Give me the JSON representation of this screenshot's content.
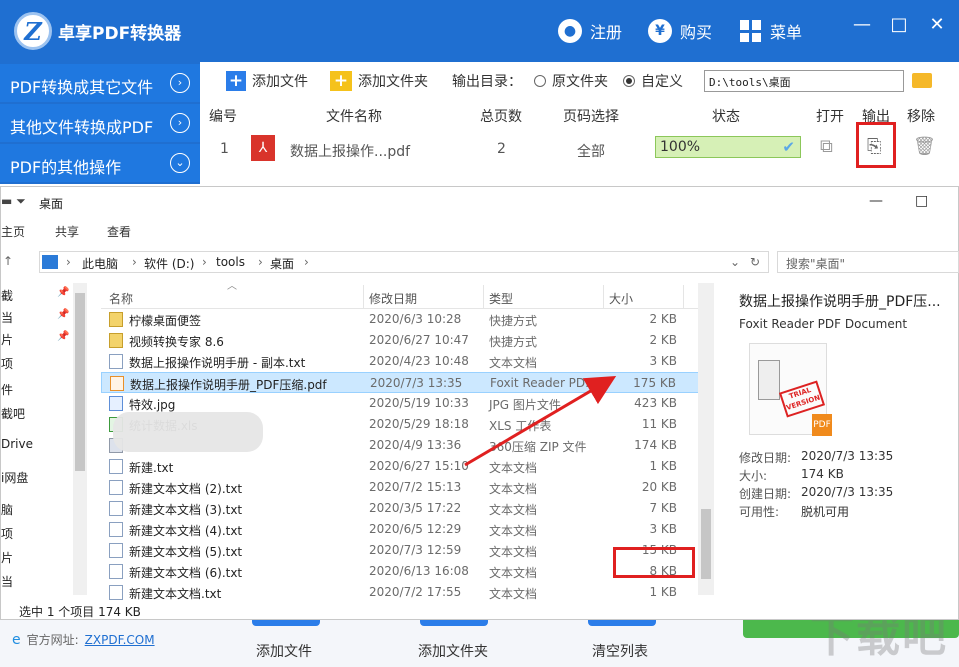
{
  "app": {
    "title": "卓享PDF转换器",
    "logo_letter": "Z",
    "titlebar_buttons": {
      "register": "注册",
      "buy": "购买",
      "menu": "菜单"
    },
    "titlebar_icons": {
      "register": "user-icon",
      "buy": "yen-icon",
      "menu": "grid-icon"
    },
    "window_controls": {
      "minimize": "—",
      "maximize": "□",
      "close": "✕"
    },
    "colors": {
      "brand": "#1f6fd1",
      "highlight": "#e02020",
      "progress": "#d6f0b6"
    }
  },
  "sidebar": {
    "items": [
      {
        "label": "PDF转换成其它文件"
      },
      {
        "label": "其他文件转换成PDF"
      },
      {
        "label": "PDF的其他操作"
      }
    ]
  },
  "toolbar": {
    "add_file": "添加文件",
    "add_folder": "添加文件夹",
    "output_dir_label": "输出目录：",
    "radio_original": "原文件夹",
    "radio_custom": "自定义",
    "output_path": "D:\\tools\\桌面"
  },
  "file_table": {
    "headers": [
      "编号",
      "文件名称",
      "总页数",
      "页码选择",
      "状态",
      "打开",
      "输出",
      "移除"
    ],
    "row": {
      "index": "1",
      "name": "数据上报操作...pdf",
      "pages": "2",
      "page_select": "全部",
      "status": "100%"
    }
  },
  "bottom": {
    "site_label": "官方网址:",
    "site_link": "ZXPDF.COM",
    "add_file": "添加文件",
    "add_folder": "添加文件夹",
    "clear_list": "清空列表",
    "watermark": "下载吧"
  },
  "explorer": {
    "title": "桌面",
    "ribbon": [
      "主页",
      "共享",
      "查看"
    ],
    "address": [
      "此电脑",
      "软件 (D:)",
      "tools",
      "桌面"
    ],
    "search_placeholder": "搜索\"桌面\"",
    "nav_items": [
      "截",
      "当",
      "片",
      "项",
      "件",
      "截吧",
      "Drive",
      "i网盘",
      "脑",
      "项",
      "片",
      "当"
    ],
    "columns": {
      "name": "名称",
      "date": "修改日期",
      "type": "类型",
      "size": "大小"
    },
    "files": [
      {
        "name": "柠檬桌面便签",
        "date": "2020/6/3 10:28",
        "type": "快捷方式",
        "size": "2 KB",
        "icon": "link"
      },
      {
        "name": "视频转换专家 8.6",
        "date": "2020/6/27 10:47",
        "type": "快捷方式",
        "size": "2 KB",
        "icon": "link"
      },
      {
        "name": "数据上报操作说明手册 - 副本.txt",
        "date": "2020/4/23 10:48",
        "type": "文本文档",
        "size": "3 KB",
        "icon": "txt"
      },
      {
        "name": "数据上报操作说明手册_PDF压缩.pdf",
        "date": "2020/7/3 13:35",
        "type": "Foxit Reader PD...",
        "size": "175 KB",
        "icon": "pdf"
      },
      {
        "name": "特效.jpg",
        "date": "2020/5/19 10:33",
        "type": "JPG 图片文件",
        "size": "423 KB",
        "icon": "jpg"
      },
      {
        "name": "统计数据.xls",
        "date": "2020/5/29 18:18",
        "type": "XLS 工作表",
        "size": "11 KB",
        "icon": "xls"
      },
      {
        "name": "",
        "date": "2020/4/9 13:36",
        "type": "360压缩 ZIP 文件",
        "size": "174 KB",
        "icon": "zip"
      },
      {
        "name": "新建.txt",
        "date": "2020/6/27 15:10",
        "type": "文本文档",
        "size": "1 KB",
        "icon": "txt"
      },
      {
        "name": "新建文本文档 (2).txt",
        "date": "2020/7/2 15:13",
        "type": "文本文档",
        "size": "20 KB",
        "icon": "txt"
      },
      {
        "name": "新建文本文档 (3).txt",
        "date": "2020/3/5 17:22",
        "type": "文本文档",
        "size": "7 KB",
        "icon": "txt"
      },
      {
        "name": "新建文本文档 (4).txt",
        "date": "2020/6/5 12:29",
        "type": "文本文档",
        "size": "3 KB",
        "icon": "txt"
      },
      {
        "name": "新建文本文档 (5).txt",
        "date": "2020/7/3 12:59",
        "type": "文本文档",
        "size": "15 KB",
        "icon": "txt"
      },
      {
        "name": "新建文本文档 (6).txt",
        "date": "2020/6/13 16:08",
        "type": "文本文档",
        "size": "8 KB",
        "icon": "txt"
      },
      {
        "name": "新建文本文档.txt",
        "date": "2020/7/2 17:55",
        "type": "文本文档",
        "size": "1 KB",
        "icon": "txt"
      }
    ],
    "preview": {
      "title": "数据上报操作说明手册_PDF压...",
      "subtitle": "Foxit Reader PDF Document",
      "stamp_text": "TRIAL VERSION",
      "props": [
        {
          "key": "修改日期:",
          "value": "2020/7/3 13:35"
        },
        {
          "key": "大小:",
          "value": "174 KB"
        },
        {
          "key": "创建日期:",
          "value": "2020/7/3 13:35"
        },
        {
          "key": "可用性:",
          "value": "脱机可用"
        }
      ]
    },
    "status": "选中 1 个项目  174 KB"
  }
}
